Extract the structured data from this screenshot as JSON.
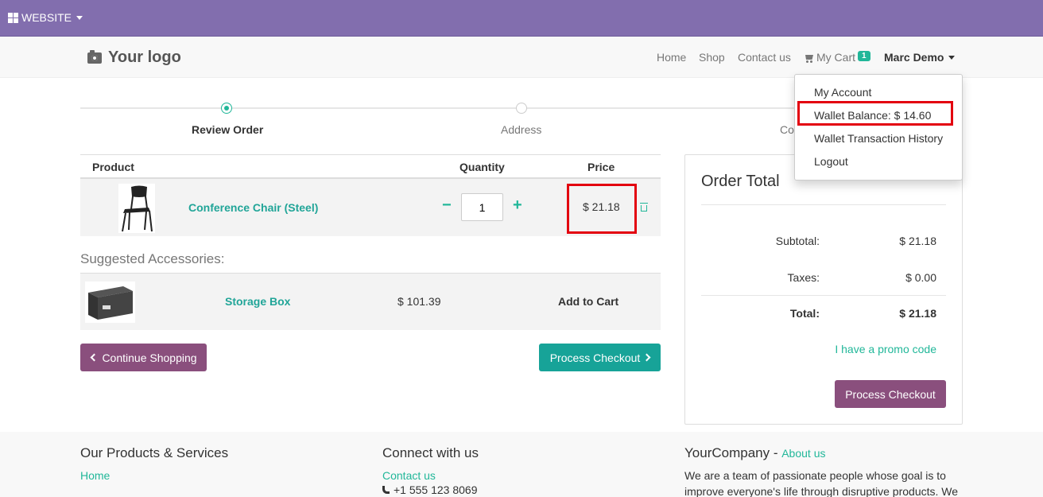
{
  "topbar": {
    "website_label": "WEBSITE"
  },
  "navbar": {
    "logo": "Your logo",
    "links": [
      "Home",
      "Shop",
      "Contact us"
    ],
    "cart_label": "My Cart",
    "cart_count": "1",
    "user_name": "Marc Demo"
  },
  "user_dropdown": {
    "items": [
      "My Account",
      "Wallet Balance: $ 14.60",
      "Wallet Transaction History",
      "Logout"
    ]
  },
  "steps": [
    "Review Order",
    "Address",
    "Co"
  ],
  "cart_table": {
    "headers": {
      "product": "Product",
      "quantity": "Quantity",
      "price": "Price"
    },
    "row": {
      "name": "Conference Chair (Steel)",
      "quantity": "1",
      "price": "$ 21.18",
      "minus": "−",
      "plus": "+"
    }
  },
  "suggested": {
    "title": "Suggested Accessories:",
    "item": {
      "name": "Storage Box",
      "price": "$ 101.39",
      "add_label": "Add to Cart"
    }
  },
  "buttons": {
    "continue_shopping": "Continue Shopping",
    "process_checkout": "Process Checkout"
  },
  "order_total": {
    "title": "Order Total",
    "subtotal_label": "Subtotal:",
    "subtotal_value": "$ 21.18",
    "taxes_label": "Taxes:",
    "taxes_value": "$ 0.00",
    "total_label": "Total:",
    "total_value": "$ 21.18",
    "promo_label": "I have a promo code",
    "checkout_label": "Process Checkout"
  },
  "footer": {
    "col1": {
      "title": "Our Products & Services",
      "link": "Home"
    },
    "col2": {
      "title": "Connect with us",
      "link": "Contact us",
      "phone": "+1 555 123 8069"
    },
    "col3": {
      "title": "YourCompany",
      "title_sep": " - ",
      "about_link": "About us",
      "text_line1": "We are a team of passionate people whose goal is to",
      "text_line2": "improve everyone's life through disruptive products. We"
    }
  },
  "colors": {
    "topbar": "#826eae",
    "accent": "#21b799",
    "purple_button": "#8a4f7d",
    "highlight_box": "#e3000f"
  }
}
